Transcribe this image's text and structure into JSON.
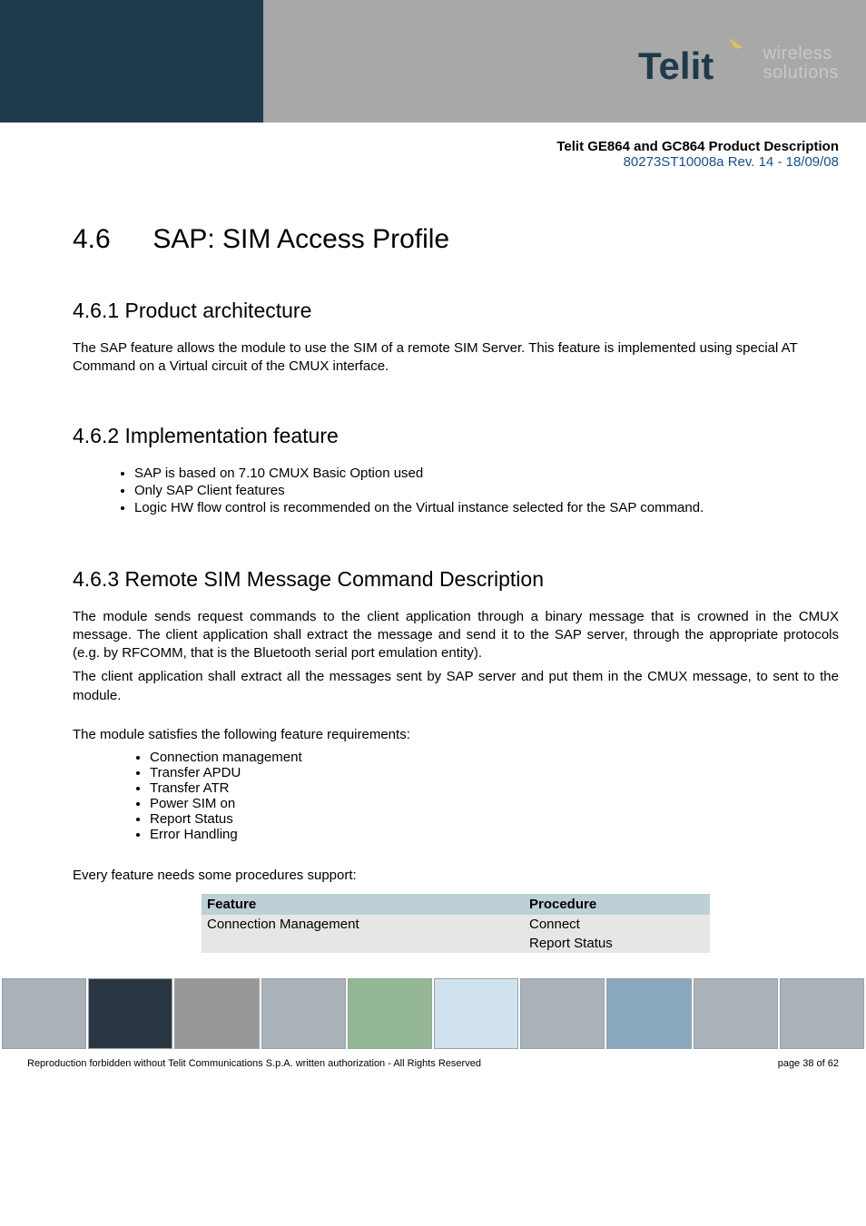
{
  "logo": {
    "brand": "Telit",
    "tagline_line1": "wireless",
    "tagline_line2": "solutions"
  },
  "meta": {
    "title": "Telit GE864 and GC864 Product Description",
    "subtitle": "80273ST10008a Rev. 14 - 18/09/08"
  },
  "section": {
    "number": "4.6",
    "title": "SAP: SIM Access Profile"
  },
  "sub1": {
    "heading": "4.6.1 Product architecture",
    "body": "The SAP feature allows the module to use the SIM of a remote SIM Server. This feature is implemented using special AT Command on a Virtual circuit of the CMUX interface."
  },
  "sub2": {
    "heading": "4.6.2 Implementation feature",
    "bullets": [
      "SAP is based on 7.10 CMUX Basic Option used",
      "Only SAP Client features",
      "Logic HW flow control is recommended on the Virtual instance selected for the SAP command."
    ]
  },
  "sub3": {
    "heading": "4.6.3 Remote SIM Message Command Description",
    "para1": "The module sends request commands to the client application through a binary message that is crowned in the CMUX message. The client application shall extract the message and send it to the SAP server, through the appropriate protocols (e.g. by RFCOMM, that is the Bluetooth serial port emulation entity).",
    "para2": "The client application shall extract all the messages sent by SAP server and put them in the CMUX message, to sent to the module.",
    "para3": "The module satisfies the following feature requirements:",
    "features": [
      "Connection management",
      "Transfer APDU",
      "Transfer ATR",
      "Power SIM on",
      "Report Status",
      "Error Handling"
    ],
    "para4": "Every feature needs some procedures support:",
    "table": {
      "headers": [
        "Feature",
        "Procedure"
      ],
      "rows": [
        {
          "feature": "Connection Management",
          "proc1": "Connect",
          "proc2": "Report Status"
        }
      ]
    }
  },
  "footer": {
    "left": "Reproduction forbidden without Telit Communications S.p.A. written authorization - All Rights Reserved",
    "right": "page 38 of 62"
  }
}
